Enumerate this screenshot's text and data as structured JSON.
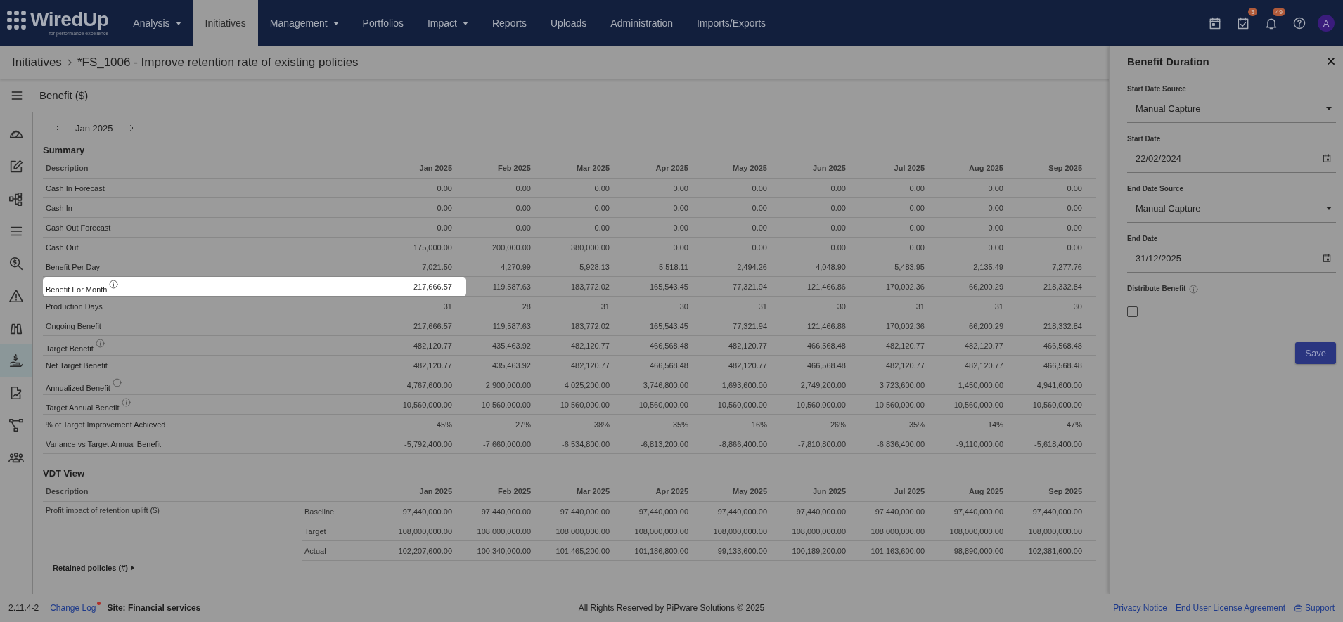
{
  "nav": {
    "logo": {
      "name": "WiredUp",
      "tagline": "for performance excellence"
    },
    "items": [
      {
        "label": "Analysis",
        "dropdown": true,
        "selected": false
      },
      {
        "label": "Initiatives",
        "dropdown": false,
        "selected": true
      },
      {
        "label": "Management",
        "dropdown": true,
        "selected": false
      },
      {
        "label": "Portfolios",
        "dropdown": false,
        "selected": false
      },
      {
        "label": "Impact",
        "dropdown": true,
        "selected": false
      },
      {
        "label": "Reports",
        "dropdown": false,
        "selected": false
      },
      {
        "label": "Uploads",
        "dropdown": false,
        "selected": false
      },
      {
        "label": "Administration",
        "dropdown": false,
        "selected": false
      },
      {
        "label": "Imports/Exports",
        "dropdown": false,
        "selected": false
      }
    ],
    "icons": [
      {
        "kind": "calendar"
      },
      {
        "kind": "tasks",
        "badge": "3"
      },
      {
        "kind": "bell",
        "badge": "49"
      },
      {
        "kind": "help"
      }
    ],
    "avatar": "A"
  },
  "breadcrumb": [
    "Initiatives",
    "*FS_1006 - Improve retention rate of existing policies"
  ],
  "section_title": "Benefit ($)",
  "sidebar": {
    "items": [
      {
        "kind": "gauge",
        "selected": false
      },
      {
        "kind": "edit",
        "selected": false
      },
      {
        "kind": "hierarchy",
        "selected": false
      },
      {
        "kind": "list",
        "selected": false
      },
      {
        "kind": "search-dollar",
        "selected": false
      },
      {
        "kind": "warning",
        "selected": false
      },
      {
        "kind": "binoculars",
        "selected": false
      },
      {
        "kind": "hand-dollar",
        "selected": true
      },
      {
        "kind": "document-edit",
        "selected": false
      },
      {
        "kind": "flow",
        "selected": false
      },
      {
        "kind": "people",
        "selected": false
      }
    ]
  },
  "period": {
    "label": "Jan 2025"
  },
  "summary": {
    "title": "Summary",
    "columns": [
      "Description",
      "Jan 2025",
      "Feb 2025",
      "Mar 2025",
      "Apr 2025",
      "May 2025",
      "Jun 2025",
      "Jul 2025",
      "Aug 2025",
      "Sep 2025"
    ],
    "rows": [
      {
        "label": "Cash In Forecast",
        "info": false,
        "highlighted": false,
        "values": [
          "0.00",
          "0.00",
          "0.00",
          "0.00",
          "0.00",
          "0.00",
          "0.00",
          "0.00",
          "0.00"
        ]
      },
      {
        "label": "Cash In",
        "info": false,
        "highlighted": false,
        "values": [
          "0.00",
          "0.00",
          "0.00",
          "0.00",
          "0.00",
          "0.00",
          "0.00",
          "0.00",
          "0.00"
        ]
      },
      {
        "label": "Cash Out Forecast",
        "info": false,
        "highlighted": false,
        "values": [
          "0.00",
          "0.00",
          "0.00",
          "0.00",
          "0.00",
          "0.00",
          "0.00",
          "0.00",
          "0.00"
        ]
      },
      {
        "label": "Cash Out",
        "info": false,
        "highlighted": false,
        "values": [
          "175,000.00",
          "200,000.00",
          "380,000.00",
          "0.00",
          "0.00",
          "0.00",
          "0.00",
          "0.00",
          "0.00"
        ]
      },
      {
        "label": "Benefit Per Day",
        "info": false,
        "highlighted": false,
        "values": [
          "7,021.50",
          "4,270.99",
          "5,928.13",
          "5,518.11",
          "2,494.26",
          "4,048.90",
          "5,483.95",
          "2,135.49",
          "7,277.76"
        ]
      },
      {
        "label": "Benefit For Month",
        "info": true,
        "highlighted": true,
        "values": [
          "217,666.57",
          "119,587.63",
          "183,772.02",
          "165,543.45",
          "77,321.94",
          "121,466.86",
          "170,002.36",
          "66,200.29",
          "218,332.84"
        ]
      },
      {
        "label": "Production Days",
        "info": false,
        "highlighted": false,
        "values": [
          "31",
          "28",
          "31",
          "30",
          "31",
          "30",
          "31",
          "31",
          "30"
        ]
      },
      {
        "label": "Ongoing Benefit",
        "info": false,
        "highlighted": false,
        "values": [
          "217,666.57",
          "119,587.63",
          "183,772.02",
          "165,543.45",
          "77,321.94",
          "121,466.86",
          "170,002.36",
          "66,200.29",
          "218,332.84"
        ]
      },
      {
        "label": "Target Benefit",
        "info": true,
        "highlighted": false,
        "values": [
          "482,120.77",
          "435,463.92",
          "482,120.77",
          "466,568.48",
          "482,120.77",
          "466,568.48",
          "482,120.77",
          "482,120.77",
          "466,568.48"
        ]
      },
      {
        "label": "Net Target Benefit",
        "info": false,
        "highlighted": false,
        "values": [
          "482,120.77",
          "435,463.92",
          "482,120.77",
          "466,568.48",
          "482,120.77",
          "466,568.48",
          "482,120.77",
          "482,120.77",
          "466,568.48"
        ]
      },
      {
        "label": "Annualized Benefit",
        "info": true,
        "highlighted": false,
        "values": [
          "4,767,600.00",
          "2,900,000.00",
          "4,025,200.00",
          "3,746,800.00",
          "1,693,600.00",
          "2,749,200.00",
          "3,723,600.00",
          "1,450,000.00",
          "4,941,600.00"
        ]
      },
      {
        "label": "Target Annual Benefit",
        "info": true,
        "highlighted": false,
        "values": [
          "10,560,000.00",
          "10,560,000.00",
          "10,560,000.00",
          "10,560,000.00",
          "10,560,000.00",
          "10,560,000.00",
          "10,560,000.00",
          "10,560,000.00",
          "10,560,000.00"
        ]
      },
      {
        "label": "% of Target Improvement Achieved",
        "info": false,
        "highlighted": false,
        "values": [
          "45%",
          "27%",
          "38%",
          "35%",
          "16%",
          "26%",
          "35%",
          "14%",
          "47%"
        ]
      },
      {
        "label": "Variance vs Target Annual Benefit",
        "info": false,
        "highlighted": false,
        "values": [
          "-5,792,400.00",
          "-7,660,000.00",
          "-6,534,800.00",
          "-6,813,200.00",
          "-8,866,400.00",
          "-7,810,800.00",
          "-6,836,400.00",
          "-9,110,000.00",
          "-5,618,400.00"
        ]
      }
    ]
  },
  "vdt": {
    "title": "VDT View",
    "columns": [
      "Description",
      "Jan 2025",
      "Feb 2025",
      "Mar 2025",
      "Apr 2025",
      "May 2025",
      "Jun 2025",
      "Jul 2025",
      "Aug 2025",
      "Sep 2025"
    ],
    "groups": [
      {
        "label": "Profit impact of retention uplift ($)",
        "rows": [
          {
            "measure": "Baseline",
            "values": [
              "97,440,000.00",
              "97,440,000.00",
              "97,440,000.00",
              "97,440,000.00",
              "97,440,000.00",
              "97,440,000.00",
              "97,440,000.00",
              "97,440,000.00",
              "97,440,000.00"
            ]
          },
          {
            "measure": "Target",
            "values": [
              "108,000,000.00",
              "108,000,000.00",
              "108,000,000.00",
              "108,000,000.00",
              "108,000,000.00",
              "108,000,000.00",
              "108,000,000.00",
              "108,000,000.00",
              "108,000,000.00"
            ]
          },
          {
            "measure": "Actual",
            "values": [
              "102,207,600.00",
              "100,340,000.00",
              "101,465,200.00",
              "101,186,800.00",
              "99,133,600.00",
              "100,189,200.00",
              "101,163,600.00",
              "98,890,000.00",
              "102,381,600.00"
            ]
          }
        ]
      }
    ],
    "next_group": "Retained policies (#)"
  },
  "panel": {
    "title": "Benefit Duration",
    "fields": [
      {
        "kind": "select",
        "label": "Start Date Source",
        "value": "Manual Capture"
      },
      {
        "kind": "date",
        "label": "Start Date",
        "value": "22/02/2024"
      },
      {
        "kind": "select",
        "label": "End Date Source",
        "value": "Manual Capture"
      },
      {
        "kind": "date",
        "label": "End Date",
        "value": "31/12/2025"
      },
      {
        "kind": "checkbox",
        "label": "Distribute Benefit",
        "checked": false
      }
    ],
    "save": "Save"
  },
  "footer": {
    "version": "2.11.4-2",
    "change_log": {
      "label": "Change Log",
      "has_update": true
    },
    "site": "Site: Financial services",
    "copyright": "All Rights Reserved by PiPware Solutions © 2025",
    "links": [
      "Privacy Notice",
      "End User License Agreement"
    ],
    "support": "Support"
  }
}
